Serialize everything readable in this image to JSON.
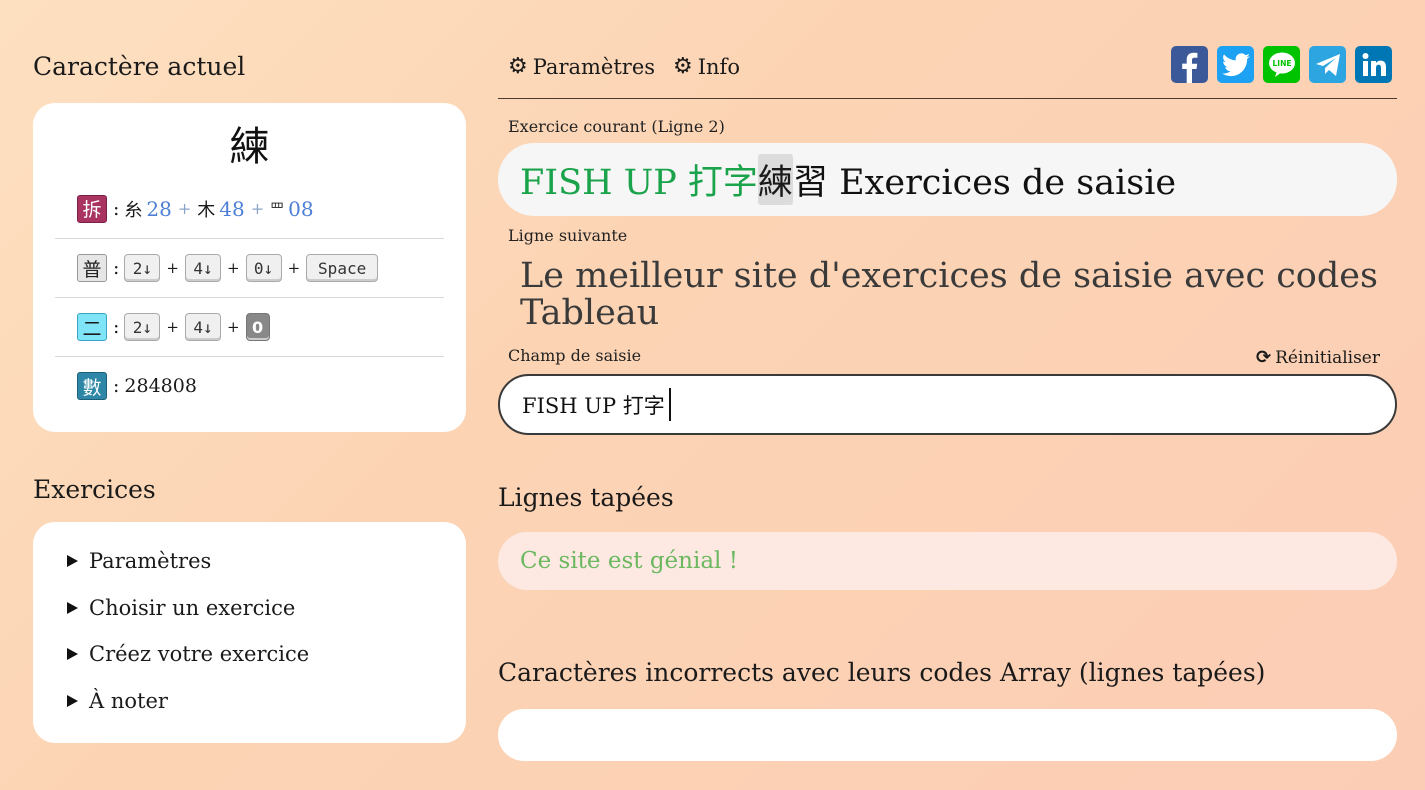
{
  "left": {
    "current_char_title": "Caractère actuel",
    "current_char": "練",
    "rows": {
      "decomp": {
        "badge": "拆",
        "colon": ":",
        "parts": [
          {
            "radical": "糸",
            "num": "28"
          },
          {
            "radical": "木",
            "num": "48"
          },
          {
            "radical": "罒",
            "num": "08"
          }
        ],
        "sep": "+"
      },
      "common": {
        "badge": "普",
        "colon": ":",
        "keys": [
          "2↓",
          "4↓",
          "0↓",
          "Space"
        ],
        "sep": "+"
      },
      "simple": {
        "badge": "二",
        "colon": ":",
        "keys": [
          "2↓",
          "4↓",
          "0"
        ],
        "sep": "+"
      },
      "number": {
        "badge": "數",
        "colon": ":",
        "value": "284808"
      }
    },
    "exercises_title": "Exercices",
    "exercise_items": [
      "Paramètres",
      "Choisir un exercice",
      "Créez votre exercice",
      "À noter"
    ]
  },
  "nav": {
    "settings": "Paramètres",
    "info": "Info",
    "gear_icon": "⚙",
    "social": [
      {
        "name": "facebook-icon",
        "color": "#3b5998"
      },
      {
        "name": "twitter-icon",
        "color": "#1da1f2"
      },
      {
        "name": "line-icon",
        "color": "#00c300"
      },
      {
        "name": "telegram-icon",
        "color": "#2ca5e0"
      },
      {
        "name": "linkedin-icon",
        "color": "#0077b5"
      }
    ]
  },
  "main": {
    "current_label": "Exercice courant (Ligne 2)",
    "current_typed": "FISH UP 打字",
    "current_cursor": "練",
    "current_rest": "習 Exercices de saisie",
    "next_label": "Ligne suivante",
    "next_line": "Le meilleur site d'exercices de saisie avec codes Tableau",
    "input_label": "Champ de saisie",
    "reset_label": "Réinitialiser",
    "reset_icon": "⟳",
    "input_value": "FISH UP 打字",
    "typed_title": "Lignes tapées",
    "typed_lines": [
      "Ce site est génial !"
    ],
    "wrong_title": "Caractères incorrects avec leurs codes Array (lignes tapées)"
  },
  "colors": {
    "typed_green": "#1aa34a",
    "done_green": "#6cb860",
    "badge_decomp": "#a93462",
    "badge_simple": "#7fe4f8",
    "badge_number": "#2e87a6"
  }
}
